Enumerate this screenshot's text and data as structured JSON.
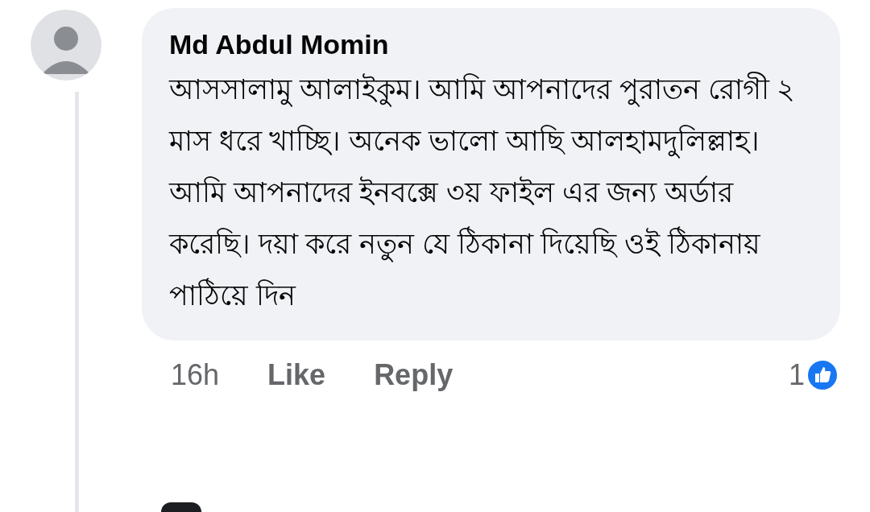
{
  "comment": {
    "author": "Md Abdul Momin",
    "text": "আসসালামু আলাইকুম। আমি আপনাদের পুরাতন রোগী ২ মাস ধরে খাচ্ছি। অনেক ভালো আছি আলহামদুলিল্লাহ। আমি আপনাদের ইনবক্সে ৩য় ফাইল এর জন্য অর্ডার করেছি। দয়া করে নতুন যে ঠিকানা দিয়েছি ওই ঠিকানায় পাঠিয়ে দিন",
    "time": "16h",
    "actions": [
      "Like",
      "Reply"
    ],
    "reaction_count": "1"
  }
}
